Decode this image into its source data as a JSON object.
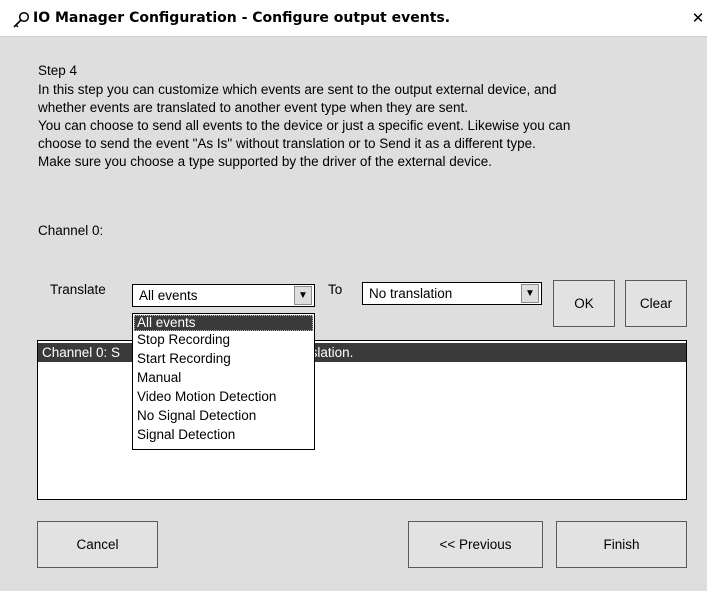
{
  "window": {
    "title": "IO Manager Configuration - Configure output events.",
    "close_glyph": "✕"
  },
  "content": {
    "step": "Step 4",
    "description_lines": [
      "In this step you can customize which events are sent to the output external device, and",
      "whether events are translated to another event type when they are sent.",
      "You can choose to send all events to the device or just a specific event. Likewise you can",
      "choose to send the event \"As Is\" without translation or to Send it as a different type.",
      "Make sure you choose a type supported by the driver of the external device."
    ],
    "channel_title": "Channel 0:"
  },
  "translate": {
    "label": "Translate",
    "selected": "All events",
    "options": [
      "All events",
      "Stop Recording",
      "Start Recording",
      "Manual",
      "Video Motion Detection",
      "No Signal Detection",
      "Signal Detection"
    ],
    "to_label": "To",
    "to_selected": "No translation",
    "ok_label": "OK",
    "clear_label": "Clear"
  },
  "list": {
    "row_left": "Channel 0:  S",
    "row_right": "nslation."
  },
  "footer": {
    "cancel_label": "Cancel",
    "previous_label": "<< Previous",
    "finish_label": "Finish"
  },
  "icons": {
    "title": "key-icon",
    "combo_arrow": "chevron-down-icon"
  }
}
